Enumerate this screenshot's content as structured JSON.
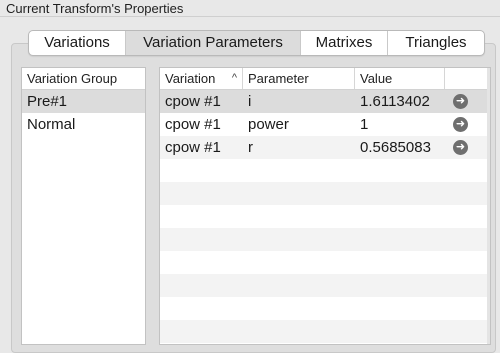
{
  "panel": {
    "title": "Current Transform's Properties"
  },
  "tabs": [
    {
      "label": "Variations"
    },
    {
      "label": "Variation Parameters"
    },
    {
      "label": "Matrixes"
    },
    {
      "label": "Triangles"
    }
  ],
  "selected_tab": "Variation Parameters",
  "groups": {
    "header": "Variation Group",
    "items": [
      {
        "label": "Pre#1"
      },
      {
        "label": "Normal"
      }
    ],
    "selected": "Pre#1"
  },
  "params": {
    "headers": {
      "variation": "Variation",
      "parameter": "Parameter",
      "value": "Value"
    },
    "sort_glyph": "^",
    "rows": [
      {
        "variation": "cpow #1",
        "parameter": "i",
        "value": "1.6113402"
      },
      {
        "variation": "cpow #1",
        "parameter": "power",
        "value": "1"
      },
      {
        "variation": "cpow #1",
        "parameter": "r",
        "value": "0.5685083"
      }
    ],
    "action_icon": "arrow-right-circle-icon"
  }
}
